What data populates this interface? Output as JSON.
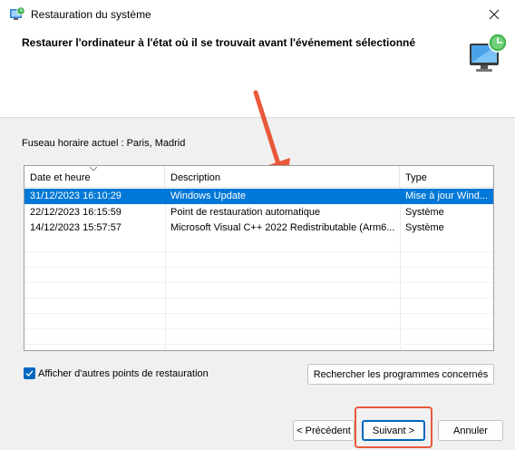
{
  "window": {
    "title": "Restauration du système",
    "close_icon": "close-icon",
    "app_icon": "system-restore-icon"
  },
  "header": {
    "title": "Restaurer l'ordinateur à l'état où il se trouvait avant l'événement sélectionné",
    "icon": "system-restore-monitor-icon"
  },
  "timezone_label": "Fuseau horaire actuel : Paris, Madrid",
  "table": {
    "columns": [
      "Date et heure",
      "Description",
      "Type"
    ],
    "sorted_column": "Date et heure",
    "rows": [
      {
        "date": "31/12/2023 16:10:29",
        "description": "Windows Update",
        "type": "Mise à jour Wind...",
        "selected": true
      },
      {
        "date": "22/12/2023 16:15:59",
        "description": "Point de restauration automatique",
        "type": "Système",
        "selected": false
      },
      {
        "date": "14/12/2023 15:57:57",
        "description": "Microsoft Visual C++ 2022 Redistributable (Arm6...",
        "type": "Système",
        "selected": false
      }
    ]
  },
  "show_more": {
    "label": "Afficher d'autres points de restauration",
    "checked": true
  },
  "buttons": {
    "scan": "Rechercher les programmes concernés",
    "previous": "< Précédent",
    "next": "Suivant >",
    "cancel": "Annuler"
  },
  "colors": {
    "accent": "#0067c0",
    "selection": "#0078d7",
    "annotation": "#e8593b"
  }
}
